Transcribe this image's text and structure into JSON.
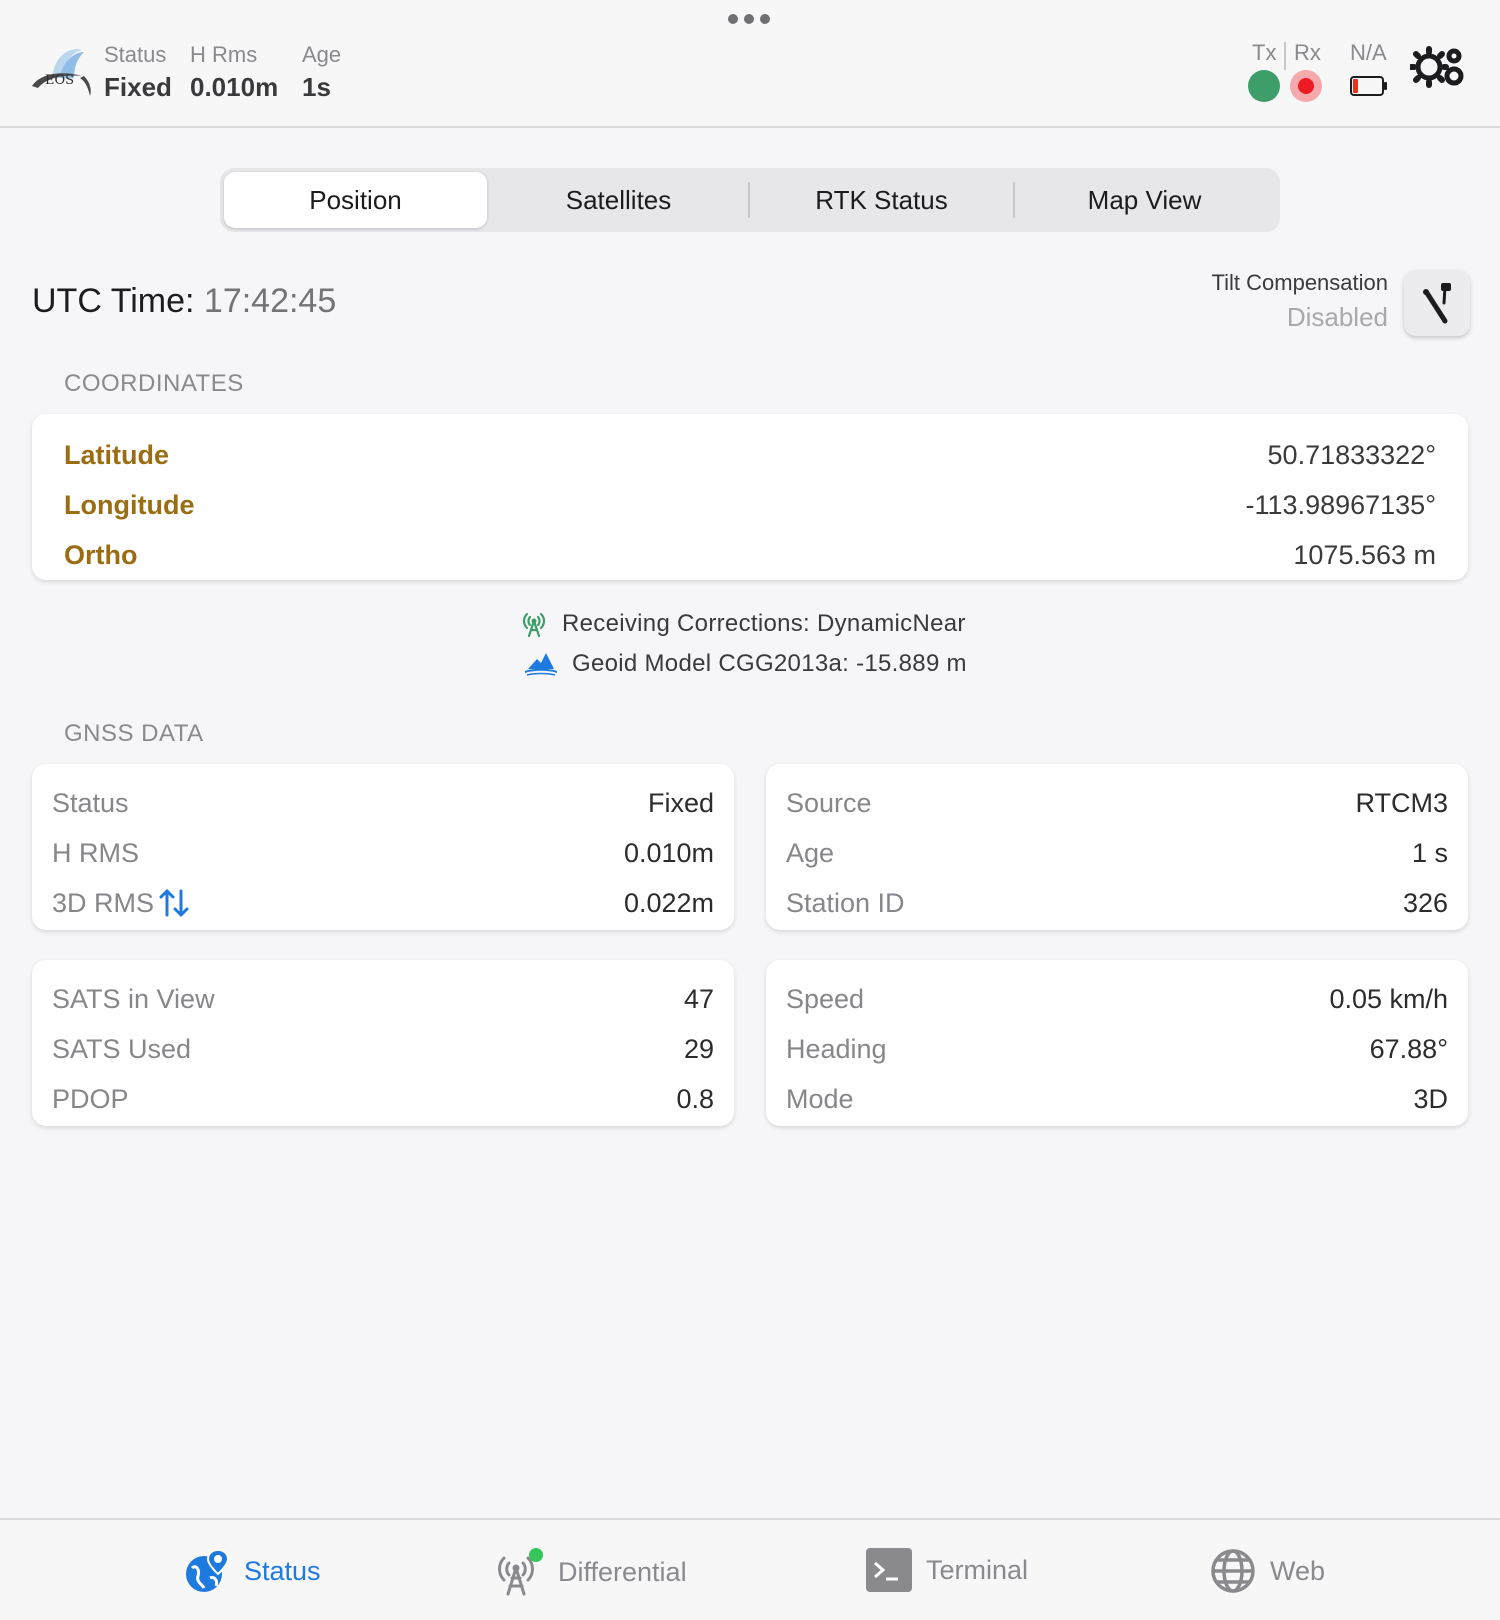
{
  "header": {
    "status_label": "Status",
    "status_value": "Fixed",
    "hrms_label": "H Rms",
    "hrms_value": "0.010m",
    "age_label": "Age",
    "age_value": "1s",
    "tx_label": "Tx",
    "rx_label": "Rx",
    "battery_label": "N/A",
    "logo_text": "EOS",
    "tx_color": "#3e9e6a",
    "rx_color": "#ef1b24"
  },
  "tabs": [
    {
      "label": "Position",
      "active": true
    },
    {
      "label": "Satellites",
      "active": false
    },
    {
      "label": "RTK Status",
      "active": false
    },
    {
      "label": "Map View",
      "active": false
    }
  ],
  "utc": {
    "label": "UTC Time:",
    "value": "17:42:45"
  },
  "tilt": {
    "label": "Tilt Compensation",
    "value": "Disabled",
    "icon": "tilt-pole-icon"
  },
  "coordinates": {
    "section_label": "COORDINATES",
    "rows": [
      {
        "label": "Latitude",
        "value": "50.71833322°"
      },
      {
        "label": "Longitude",
        "value": "-113.98967135°"
      },
      {
        "label": "Ortho",
        "value": "1075.563 m"
      }
    ]
  },
  "corrections": {
    "text": "Receiving Corrections: DynamicNear",
    "icon": "antenna-icon"
  },
  "geoid": {
    "text": "Geoid Model CGG2013a: -15.889 m",
    "icon": "geoid-icon"
  },
  "gnss": {
    "section_label": "GNSS DATA",
    "cards": [
      {
        "rows": [
          {
            "label": "Status",
            "value": "Fixed"
          },
          {
            "label": "H RMS",
            "value": "0.010m"
          },
          {
            "label": "3D RMS",
            "value": "0.022m"
          }
        ]
      },
      {
        "rows": [
          {
            "label": "Source",
            "value": "RTCM3"
          },
          {
            "label": "Age",
            "value": "1 s"
          },
          {
            "label": "Station ID",
            "value": "326"
          }
        ]
      },
      {
        "rows": [
          {
            "label": "SATS in View",
            "value": "47"
          },
          {
            "label": "SATS Used",
            "value": "29"
          },
          {
            "label": "PDOP",
            "value": "0.8"
          }
        ]
      },
      {
        "rows": [
          {
            "label": "Speed",
            "value": "0.05 km/h"
          },
          {
            "label": "Heading",
            "value": "67.88°"
          },
          {
            "label": "Mode",
            "value": "3D"
          }
        ]
      }
    ]
  },
  "bottom_nav": [
    {
      "label": "Status",
      "icon": "globe-pin-icon",
      "active": true
    },
    {
      "label": "Differential",
      "icon": "antenna-tower-icon",
      "active": false
    },
    {
      "label": "Terminal",
      "icon": "terminal-icon",
      "active": false
    },
    {
      "label": "Web",
      "icon": "globe-icon",
      "active": false
    }
  ],
  "colors": {
    "accent": "#1f7ae0",
    "coord_label": "#9a6d12",
    "differential_dot": "#34c759"
  }
}
